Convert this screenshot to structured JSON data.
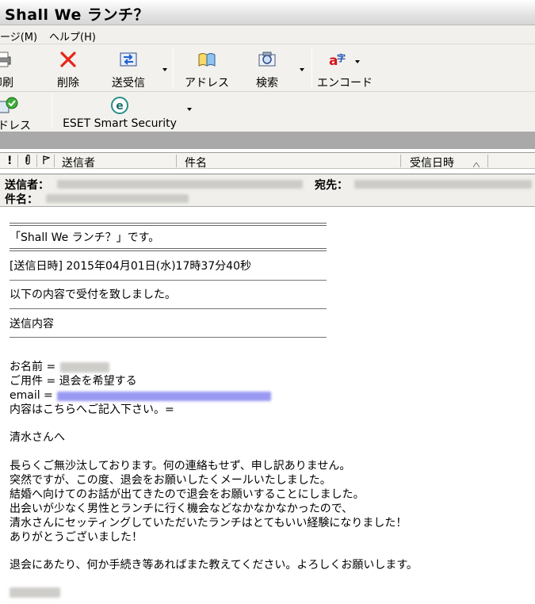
{
  "window": {
    "title": "Shall We ランチ？"
  },
  "menu": {
    "items": [
      "ージ(M)",
      "ヘルプ(H)"
    ]
  },
  "toolbar1": {
    "print": "印刷",
    "delete": "削除",
    "sendrecv": "送受信",
    "address": "アドレス",
    "search": "検索",
    "encode": "エンコード"
  },
  "toolbar2": {
    "address": "アドレス",
    "eset": "ESET Smart Security"
  },
  "list_header": {
    "sender": "送信者",
    "subject": "件名",
    "received": "受信日時"
  },
  "preview": {
    "from_label": "送信者：",
    "to_label": "宛先：",
    "subject_label": "件名："
  },
  "body": {
    "line1": "「Shall  We  ランチ？」です。",
    "line2": "[送信日時] 2015年04月01日(水)17時37分40秒",
    "line3": "以下の内容で受付を致しました。",
    "line4": "送信内容",
    "name_label": "お名前 =",
    "inquiry": " ご用件 = 退会を希望する",
    "email_label": " email =",
    "content": " 内容はこちらへご記入下さい。=",
    "greeting": "清水さんへ",
    "p1": "長らくご無沙汰しております。何の連絡もせず、申し訳ありません。",
    "p2": "突然ですが、この度、退会をお願いしたくメールいたしました。",
    "p3": "結婚へ向けてのお話が出てきたので退会をお願いすることにしました。",
    "p4": "出会いが少なく男性とランチに行く機会などなかなかなかったので、",
    "p5": "清水さんにセッティングしていただいたランチはとてもいい経験になりました！",
    "p6": "ありがとうございました！",
    "p7": "退会にあたり、何か手続き等あればまた教えてください。よろしくお願いします。"
  },
  "colors": {
    "accent_link": "#7b7be8",
    "toolbar_bg": "#f2f1ed"
  }
}
